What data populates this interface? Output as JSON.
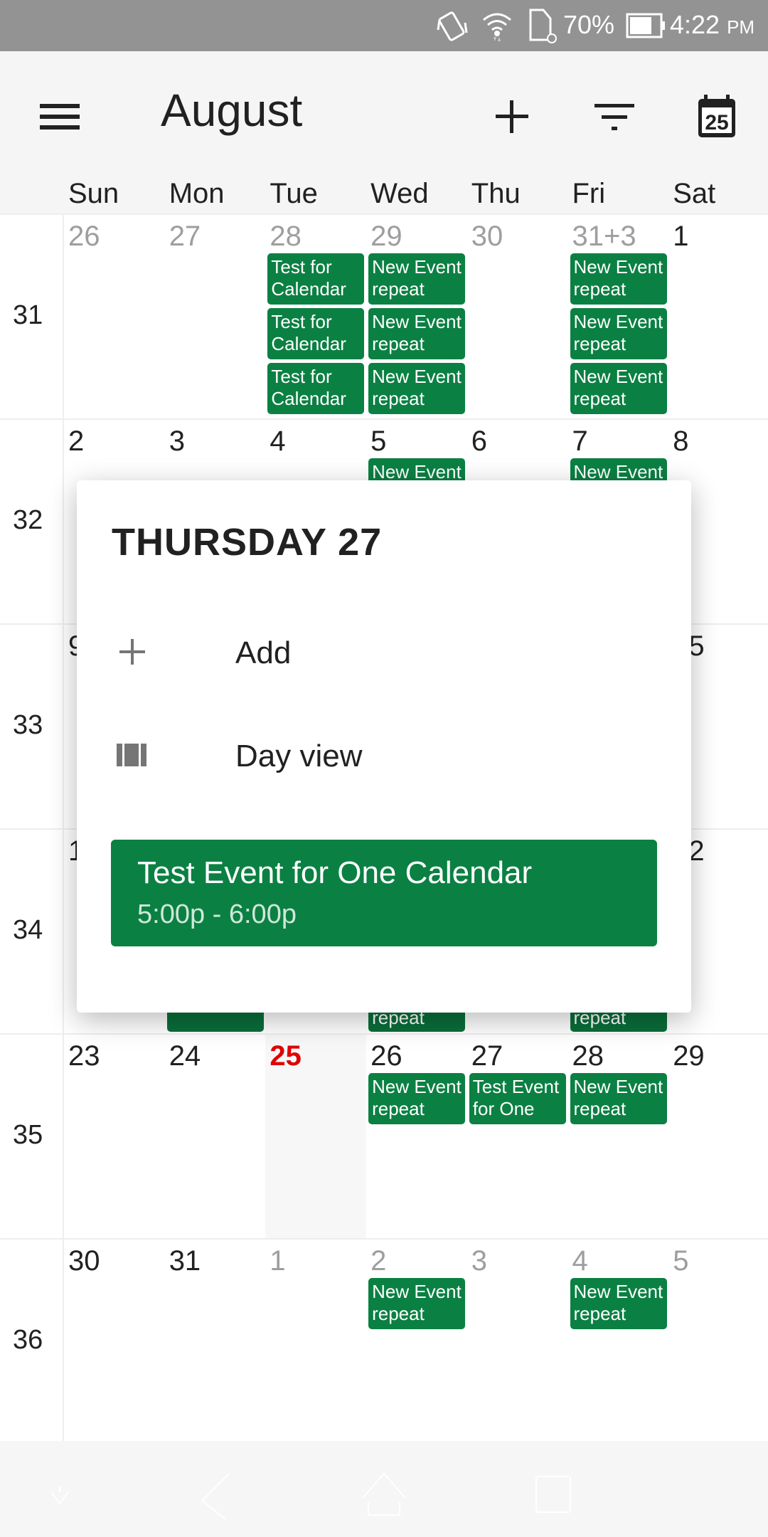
{
  "status_bar": {
    "battery": "70%",
    "time": "4:22",
    "ampm": "PM",
    "icons": [
      "vibrate-icon",
      "wifi-icon",
      "sd-card-icon",
      "battery-icon"
    ]
  },
  "toolbar": {
    "title": "August",
    "today_icon_day": "25",
    "icons": [
      "menu-icon",
      "add-icon",
      "filter-icon",
      "today-icon"
    ]
  },
  "weekdays": [
    "Sun",
    "Mon",
    "Tue",
    "Wed",
    "Thu",
    "Fri",
    "Sat"
  ],
  "colors": {
    "event": "#0b8043",
    "today": "#e00000",
    "status_bar": "#939393"
  },
  "weeks": [
    {
      "number": "31",
      "days": [
        {
          "label": "26",
          "muted": true,
          "events": []
        },
        {
          "label": "27",
          "muted": true,
          "events": []
        },
        {
          "label": "28",
          "muted": true,
          "events": [
            "Test for Calendar",
            "Test for Calendar",
            "Test for Calendar"
          ]
        },
        {
          "label": "29",
          "muted": true,
          "events": [
            "New Event repeat",
            "New Event repeat",
            "New Event repeat"
          ]
        },
        {
          "label": "30",
          "muted": true,
          "events": []
        },
        {
          "label": "31+3",
          "muted": true,
          "events": [
            "New Event repeat",
            "New Event repeat",
            "New Event repeat"
          ]
        },
        {
          "label": "1",
          "events": []
        }
      ]
    },
    {
      "number": "32",
      "days": [
        {
          "label": "2",
          "events": []
        },
        {
          "label": "3",
          "events": []
        },
        {
          "label": "4",
          "events": []
        },
        {
          "label": "5",
          "events": [
            "New Event"
          ]
        },
        {
          "label": "6",
          "events": []
        },
        {
          "label": "7",
          "events": [
            "New Event"
          ]
        },
        {
          "label": "8",
          "events": []
        }
      ]
    },
    {
      "number": "33",
      "days": [
        {
          "label": "9",
          "events": []
        },
        {
          "label": "",
          "events": []
        },
        {
          "label": "",
          "events": []
        },
        {
          "label": "",
          "events": []
        },
        {
          "label": "",
          "events": []
        },
        {
          "label": "",
          "events": []
        },
        {
          "label": "15",
          "events": []
        }
      ]
    },
    {
      "number": "34",
      "days": [
        {
          "label": "16",
          "events": []
        },
        {
          "label": "",
          "tail_events": [
            ""
          ]
        },
        {
          "label": "",
          "events": []
        },
        {
          "label": "",
          "tail_events": [
            "repeat"
          ]
        },
        {
          "label": "",
          "events": []
        },
        {
          "label": "",
          "tail_events": [
            "repeat"
          ]
        },
        {
          "label": "22",
          "events": []
        }
      ]
    },
    {
      "number": "35",
      "days": [
        {
          "label": "23",
          "events": []
        },
        {
          "label": "24",
          "events": []
        },
        {
          "label": "25",
          "today": true,
          "events": []
        },
        {
          "label": "26",
          "events": [
            "New Event repeat"
          ]
        },
        {
          "label": "27",
          "events": [
            "Test Event for One"
          ]
        },
        {
          "label": "28",
          "events": [
            "New Event repeat"
          ]
        },
        {
          "label": "29",
          "events": []
        }
      ]
    },
    {
      "number": "36",
      "days": [
        {
          "label": "30",
          "events": []
        },
        {
          "label": "31",
          "events": []
        },
        {
          "label": "1",
          "muted": true,
          "events": []
        },
        {
          "label": "2",
          "muted": true,
          "events": [
            "New Event repeat"
          ]
        },
        {
          "label": "3",
          "muted": true,
          "events": []
        },
        {
          "label": "4",
          "muted": true,
          "events": [
            "New Event repeat"
          ]
        },
        {
          "label": "5",
          "muted": true,
          "events": []
        }
      ]
    }
  ],
  "popup": {
    "title": "THURSDAY 27",
    "add_label": "Add",
    "day_view_label": "Day view",
    "event": {
      "title": "Test Event for One Calendar",
      "time": "5:00p - 6:00p"
    }
  },
  "nav_bar": {
    "icons": [
      "hide-keyboard-icon",
      "back-icon",
      "home-icon",
      "recents-icon"
    ]
  }
}
